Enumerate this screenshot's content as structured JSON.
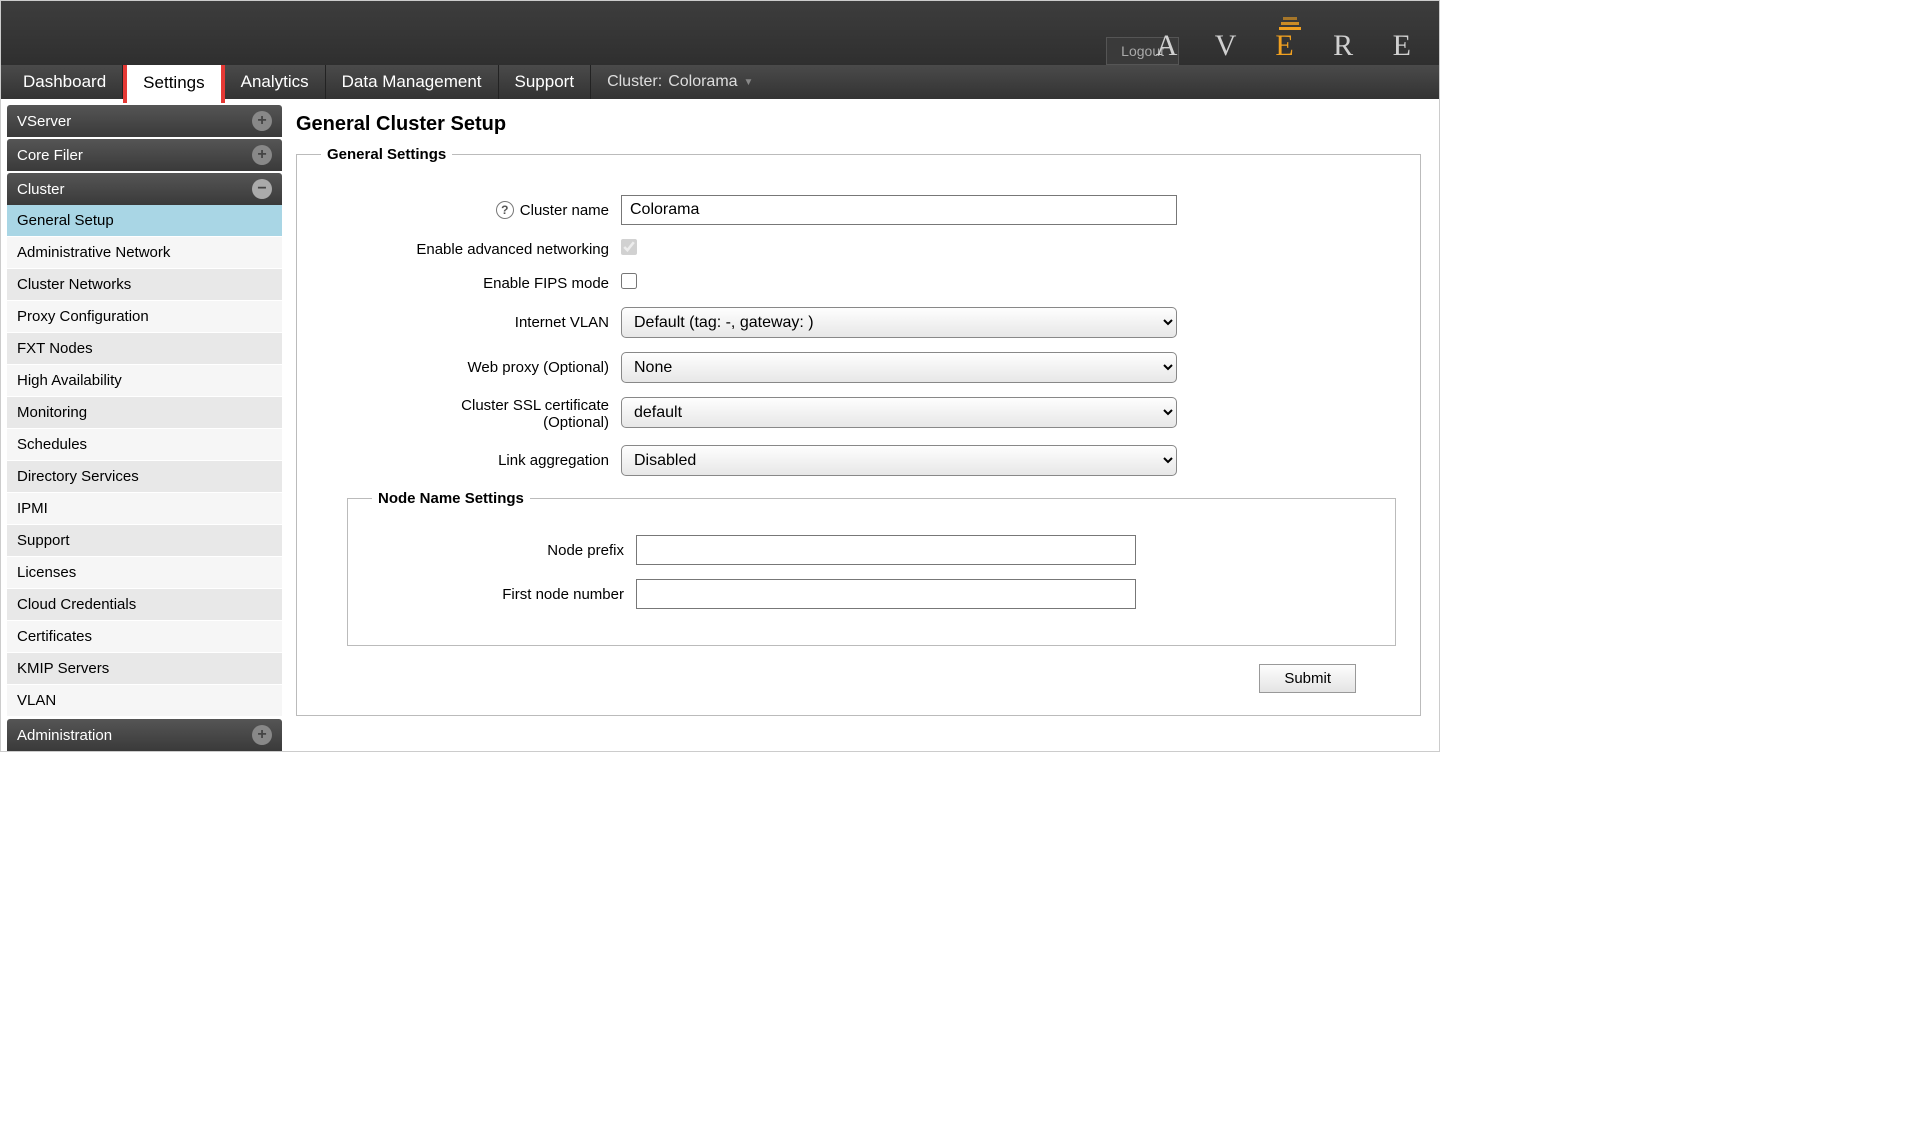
{
  "header": {
    "logout": "Logout",
    "logo_letters": [
      "A",
      "V",
      "E",
      "R",
      "E"
    ]
  },
  "tabs": {
    "dashboard": "Dashboard",
    "settings": "Settings",
    "analytics": "Analytics",
    "data_mgmt": "Data Management",
    "support": "Support"
  },
  "cluster_indicator": {
    "prefix": "Cluster:",
    "name": "Colorama"
  },
  "sidebar": {
    "sections": {
      "vserver": {
        "label": "VServer"
      },
      "corefiler": {
        "label": "Core Filer"
      },
      "cluster": {
        "label": "Cluster",
        "items": [
          "General Setup",
          "Administrative Network",
          "Cluster Networks",
          "Proxy Configuration",
          "FXT Nodes",
          "High Availability",
          "Monitoring",
          "Schedules",
          "Directory Services",
          "IPMI",
          "Support",
          "Licenses",
          "Cloud Credentials",
          "Certificates",
          "KMIP Servers",
          "VLAN"
        ]
      },
      "administration": {
        "label": "Administration"
      }
    }
  },
  "page": {
    "title": "General Cluster Setup",
    "general_legend": "General Settings",
    "node_legend": "Node Name Settings",
    "submit": "Submit"
  },
  "form": {
    "cluster_name": {
      "label": "Cluster name",
      "value": "Colorama"
    },
    "adv_net": {
      "label": "Enable advanced networking",
      "checked": true
    },
    "fips": {
      "label": "Enable FIPS mode",
      "checked": false
    },
    "vlan": {
      "label": "Internet VLAN",
      "value": "Default (tag: -, gateway:            )"
    },
    "webproxy": {
      "label": "Web proxy (Optional)",
      "value": "None"
    },
    "ssl": {
      "label1": "Cluster SSL certificate",
      "label2": "(Optional)",
      "value": "default"
    },
    "linkagg": {
      "label": "Link aggregation",
      "value": "Disabled"
    },
    "node_prefix": {
      "label": "Node prefix",
      "value": ""
    },
    "first_node": {
      "label": "First node number",
      "value": ""
    }
  }
}
